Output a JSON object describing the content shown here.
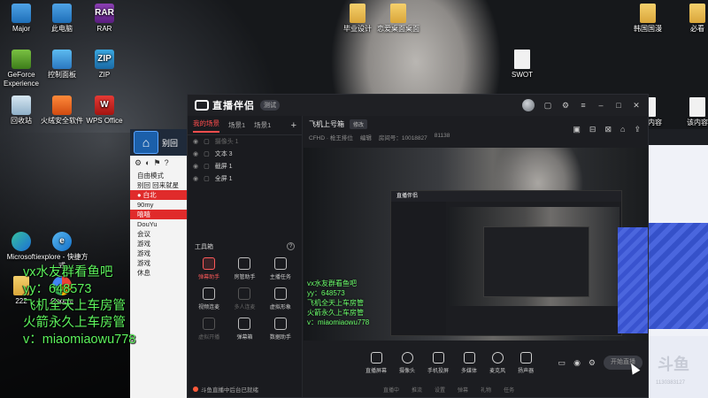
{
  "desktop": {
    "icons": [
      {
        "label": "Major",
        "glyph": "",
        "cls": "ic-pc",
        "icon": "user-folder-icon"
      },
      {
        "label": "此电脑",
        "glyph": "",
        "cls": "ic-pc",
        "icon": "computer-icon"
      },
      {
        "label": "RAR",
        "glyph": "RAR",
        "cls": "ic-rar",
        "icon": "winrar-icon"
      },
      {
        "label": "GeForce Experience",
        "glyph": "",
        "cls": "ic-nv",
        "icon": "nvidia-icon"
      },
      {
        "label": "控制面板",
        "glyph": "",
        "cls": "ic-ctrl",
        "icon": "control-panel-icon"
      },
      {
        "label": "ZIP",
        "glyph": "ZIP",
        "cls": "ic-zip",
        "icon": "zip-icon"
      },
      {
        "label": "回收站",
        "glyph": "",
        "cls": "ic-bin",
        "icon": "recycle-bin-icon"
      },
      {
        "label": "火绒安全软件",
        "glyph": "",
        "cls": "ic-fire",
        "icon": "huorong-icon"
      },
      {
        "label": "WPS Office",
        "glyph": "W",
        "cls": "ic-wps",
        "icon": "wps-icon"
      },
      {
        "label": "Microsoft",
        "glyph": "",
        "cls": "ic-edge",
        "icon": "edge-icon"
      },
      {
        "label": "iexplore - 快捷方式",
        "glyph": "e",
        "cls": "ic-ie",
        "icon": "ie-icon"
      },
      {
        "label": "222",
        "glyph": "",
        "cls": "ic-folder",
        "icon": "folder-icon"
      },
      {
        "label": "Google",
        "glyph": "",
        "cls": "ic-gg",
        "icon": "chrome-icon"
      },
      {
        "label": "毕业设计",
        "glyph": "",
        "cls": "ic-folder",
        "icon": "folder-icon"
      },
      {
        "label": "恋爱桌面桌面",
        "glyph": "",
        "cls": "ic-folder",
        "icon": "folder-icon"
      },
      {
        "label": "SWOT",
        "glyph": "",
        "cls": "ic-file",
        "icon": "document-icon"
      },
      {
        "label": "韩国国漫",
        "glyph": "",
        "cls": "ic-folder",
        "icon": "folder-icon"
      },
      {
        "label": "必看",
        "glyph": "",
        "cls": "ic-folder",
        "icon": "folder-icon"
      },
      {
        "label": "以下内容",
        "glyph": "",
        "cls": "ic-file",
        "icon": "document-icon"
      },
      {
        "label": "该内容",
        "glyph": "",
        "cls": "ic-file",
        "icon": "document-icon"
      }
    ],
    "overlay_lines": [
      "vx水友群看鱼吧",
      "yy：648573",
      "飞机全天上车房管",
      "火箭永久上车房管",
      "v：miaomiaowu778"
    ]
  },
  "left_window": {
    "title": "别回",
    "tools": [
      "⚙",
      "◐",
      "⚑",
      "?"
    ],
    "items": [
      {
        "text": "自由模式",
        "hl": false
      },
      {
        "text": "别回 回来就星",
        "hl": false
      },
      {
        "text": "● 白北",
        "hl": true
      },
      {
        "text": "90my",
        "hl": false
      },
      {
        "text": "嘻嘻",
        "hl": true
      },
      {
        "text": "DouYu",
        "hl": false
      },
      {
        "text": "会议",
        "hl": false
      },
      {
        "text": "游戏",
        "hl": false
      },
      {
        "text": "游戏",
        "hl": false
      },
      {
        "text": "游戏",
        "hl": false
      },
      {
        "text": "休息",
        "hl": false
      }
    ]
  },
  "right_panel": {
    "logo": "斗鱼",
    "tag": "1130383127"
  },
  "app": {
    "name": "直播伴侣",
    "version": "测试",
    "scene_tabs": [
      "我的场景",
      "场景1",
      "场景1"
    ],
    "sources": [
      {
        "name": "摄像头 1",
        "dim": true
      },
      {
        "name": "文本 3",
        "dim": false
      },
      {
        "name": "截屏 1",
        "dim": false
      },
      {
        "name": "全屏 1",
        "dim": false
      }
    ],
    "tools_title": "工具箱",
    "tools_help": "?",
    "tools": [
      {
        "label": "弹幕助手",
        "state": "hot"
      },
      {
        "label": "房管助手",
        "state": ""
      },
      {
        "label": "主播任务",
        "state": ""
      },
      {
        "label": "视频连麦",
        "state": ""
      },
      {
        "label": "多人连麦",
        "state": "off"
      },
      {
        "label": "虚拟形象",
        "state": ""
      },
      {
        "label": "虚拟开播",
        "state": "off"
      },
      {
        "label": "弹幕箱",
        "state": ""
      },
      {
        "label": "数据助手",
        "state": ""
      }
    ],
    "status_text": "斗鱼直播中后台已就绪",
    "room": {
      "title": "飞机上号箱",
      "edit_label": "修改",
      "category": "CFHD · 枪王排位",
      "editor_label": "编辑",
      "room_id": "房间号：10018827",
      "fans": "81138"
    },
    "header_icons": [
      "▣",
      "⊟",
      "⊠",
      "⌂",
      "⇪"
    ],
    "preview": {
      "inner_title": "直播伴侣",
      "overlay_lines": [
        "vx水友群看鱼吧",
        "yy：648573",
        "飞机全天上车房管",
        "火箭永久上车房管",
        "v：miaomiaowu778"
      ]
    },
    "controls": [
      {
        "label": "直播屏幕",
        "shape": ""
      },
      {
        "label": "摄像头",
        "shape": "round"
      },
      {
        "label": "手机投屏",
        "shape": ""
      },
      {
        "label": "多媒体",
        "shape": ""
      },
      {
        "label": "麦克风",
        "shape": "round"
      },
      {
        "label": "扬声器",
        "shape": ""
      }
    ],
    "start_label": "开始直播",
    "footer_items": [
      "直播中",
      "推流",
      "设置",
      "弹幕",
      "礼物",
      "任务"
    ]
  }
}
